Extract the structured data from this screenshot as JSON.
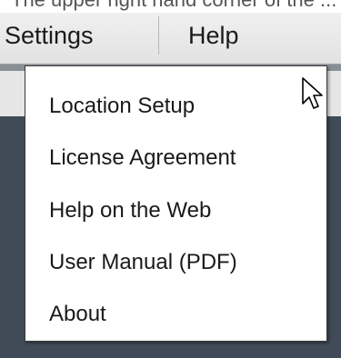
{
  "top_strip_text": "The upper right hand corner of the ...",
  "menubar": {
    "settings_label": "Settings",
    "help_label": "Help"
  },
  "help_menu": {
    "items": [
      {
        "label": "Location Setup"
      },
      {
        "label": "License Agreement"
      },
      {
        "label": "Help on the Web"
      },
      {
        "label": "User Manual (PDF)"
      },
      {
        "label": "About"
      }
    ]
  },
  "icons": {
    "cursor": "mouse-pointer-icon"
  }
}
